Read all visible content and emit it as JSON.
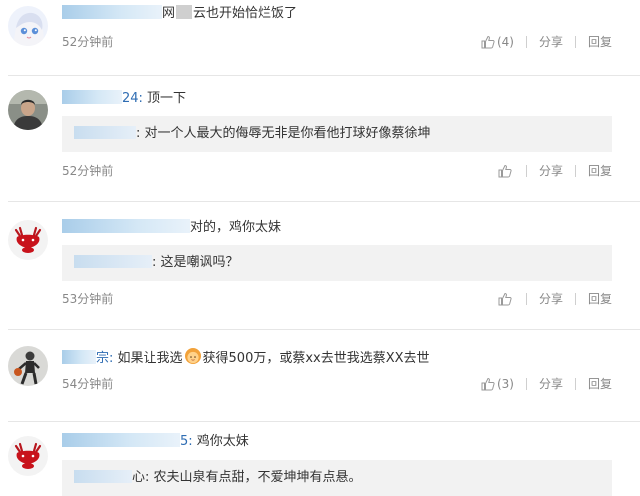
{
  "like_icon": "thumbs-up-icon",
  "share_icon": "share-icon",
  "reply_icon": "reply-icon",
  "comments": [
    {
      "name_tail": "",
      "text_before": "网",
      "text_after": "云也开始恰烂饭了",
      "time": "52分钟前",
      "likes": "(4)",
      "share": "分享",
      "reply": "回复"
    },
    {
      "name_tail": "24:",
      "text": " 顶一下",
      "quote": ": 对一个人最大的侮辱无非是你看他打球好像蔡徐坤",
      "time": "52分钟前",
      "likes": "",
      "share": "分享",
      "reply": "回复"
    },
    {
      "name_tail": "",
      "text": "对的，鸡你太妹",
      "quote": ": 这是嘲讽吗？",
      "time": "53分钟前",
      "likes": "",
      "share": "分享",
      "reply": "回复"
    },
    {
      "name_tail": "宗:",
      "text_before": " 如果让我选",
      "text_after": "获得500万，或蔡xx去世我选蔡XX去世",
      "time": "54分钟前",
      "likes": "(3)",
      "share": "分享",
      "reply": "回复"
    },
    {
      "name_tail": "5:",
      "text": " 鸡你太妹",
      "quote": "心: 农夫山泉有点甜，不爱坤坤有点悬。",
      "quote_name_tail": "",
      "time": "",
      "likes": "",
      "share": "",
      "reply": ""
    }
  ]
}
